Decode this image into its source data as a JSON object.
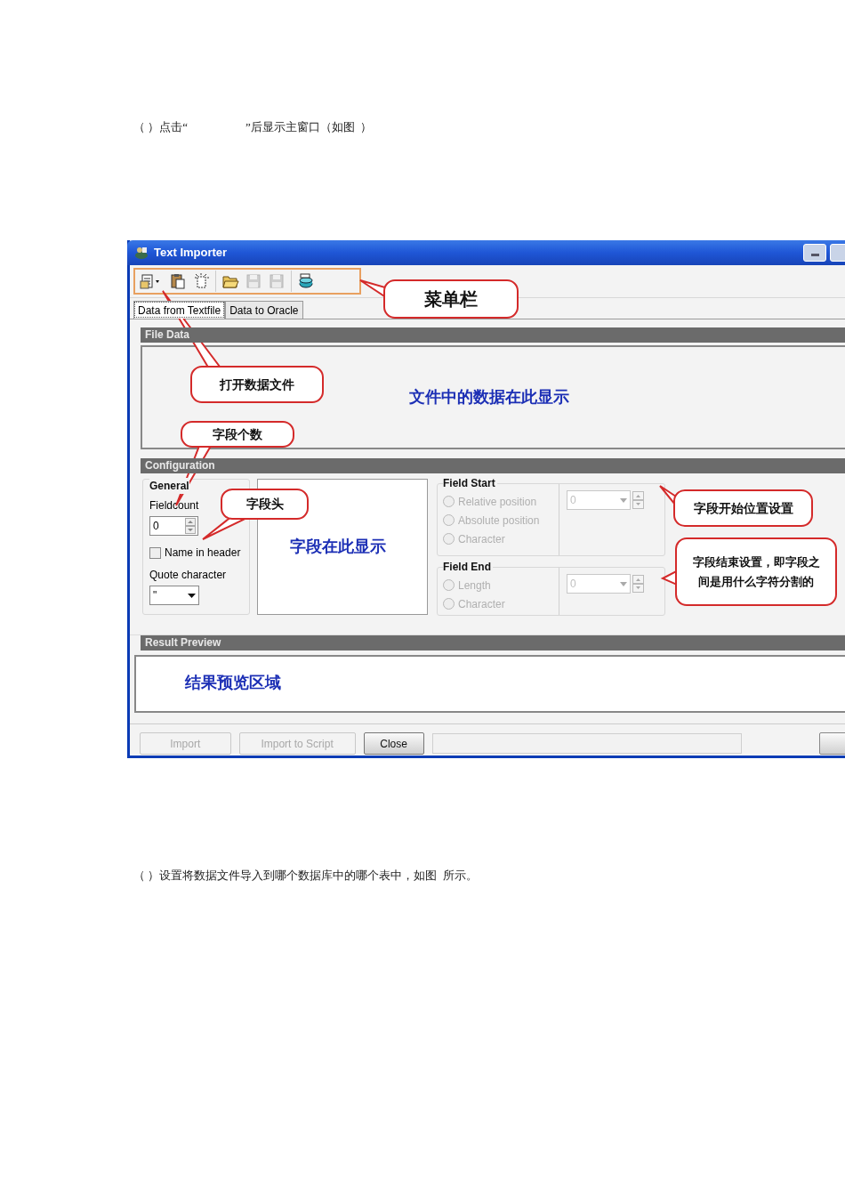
{
  "document": {
    "paragraphs": [
      "（ ）点击“                    ”后显示主窗口（如图  ）",
      "（ ）设置将数据文件导入到哪个数据库中的哪个表中，如图  所示。"
    ]
  },
  "window": {
    "title": "Text Importer"
  },
  "toolbar": [
    {
      "kind": "document",
      "disabled": false
    },
    {
      "kind": "paste",
      "disabled": false
    },
    {
      "kind": "new",
      "disabled": false
    },
    {
      "kind": "open",
      "disabled": false
    },
    {
      "kind": "save",
      "disabled": true
    },
    {
      "kind": "saveas",
      "disabled": true
    },
    {
      "kind": "database",
      "disabled": false
    }
  ],
  "tabs": [
    {
      "label": "Data from Textfile",
      "selected": true
    },
    {
      "label": "Data to Oracle",
      "selected": false
    }
  ],
  "file_data": {
    "header": "File Data",
    "annotation": "文件中的数据在此显示"
  },
  "configuration": {
    "header": "Configuration",
    "general": {
      "title": "General",
      "fieldcount_label": "Fieldcount",
      "fieldcount_value": "0",
      "name_in_header": {
        "label": "Name in header",
        "checked": false
      },
      "quote_label": "Quote character",
      "quote_value": "\""
    },
    "fields_annotation": "字段在此显示",
    "field_start": {
      "title": "Field Start",
      "value": "0",
      "options": [
        {
          "label": "Relative position",
          "selected": false,
          "disabled": true
        },
        {
          "label": "Absolute position",
          "selected": false,
          "disabled": true
        },
        {
          "label": "Character",
          "selected": false,
          "disabled": true
        }
      ]
    },
    "field_end": {
      "title": "Field End",
      "value": "0",
      "options": [
        {
          "label": "Length",
          "selected": false,
          "disabled": true
        },
        {
          "label": "Character",
          "selected": false,
          "disabled": true
        }
      ]
    }
  },
  "result_preview": {
    "header": "Result Preview",
    "annotation": "结果预览区域"
  },
  "progress": {
    "level": 0
  },
  "buttons": [
    {
      "label": "Import",
      "disabled": true
    },
    {
      "label": "Import to Script",
      "disabled": true
    },
    {
      "label": "Close",
      "disabled": false
    }
  ],
  "callouts": [
    {
      "text": "菜单栏"
    },
    {
      "text": "打开数据文件"
    },
    {
      "text": "字段个数"
    },
    {
      "text": "字段头"
    },
    {
      "text": "字段开始位置设置"
    },
    {
      "text": "字段结束设置，即字段之间是用什么字符分割的"
    }
  ]
}
